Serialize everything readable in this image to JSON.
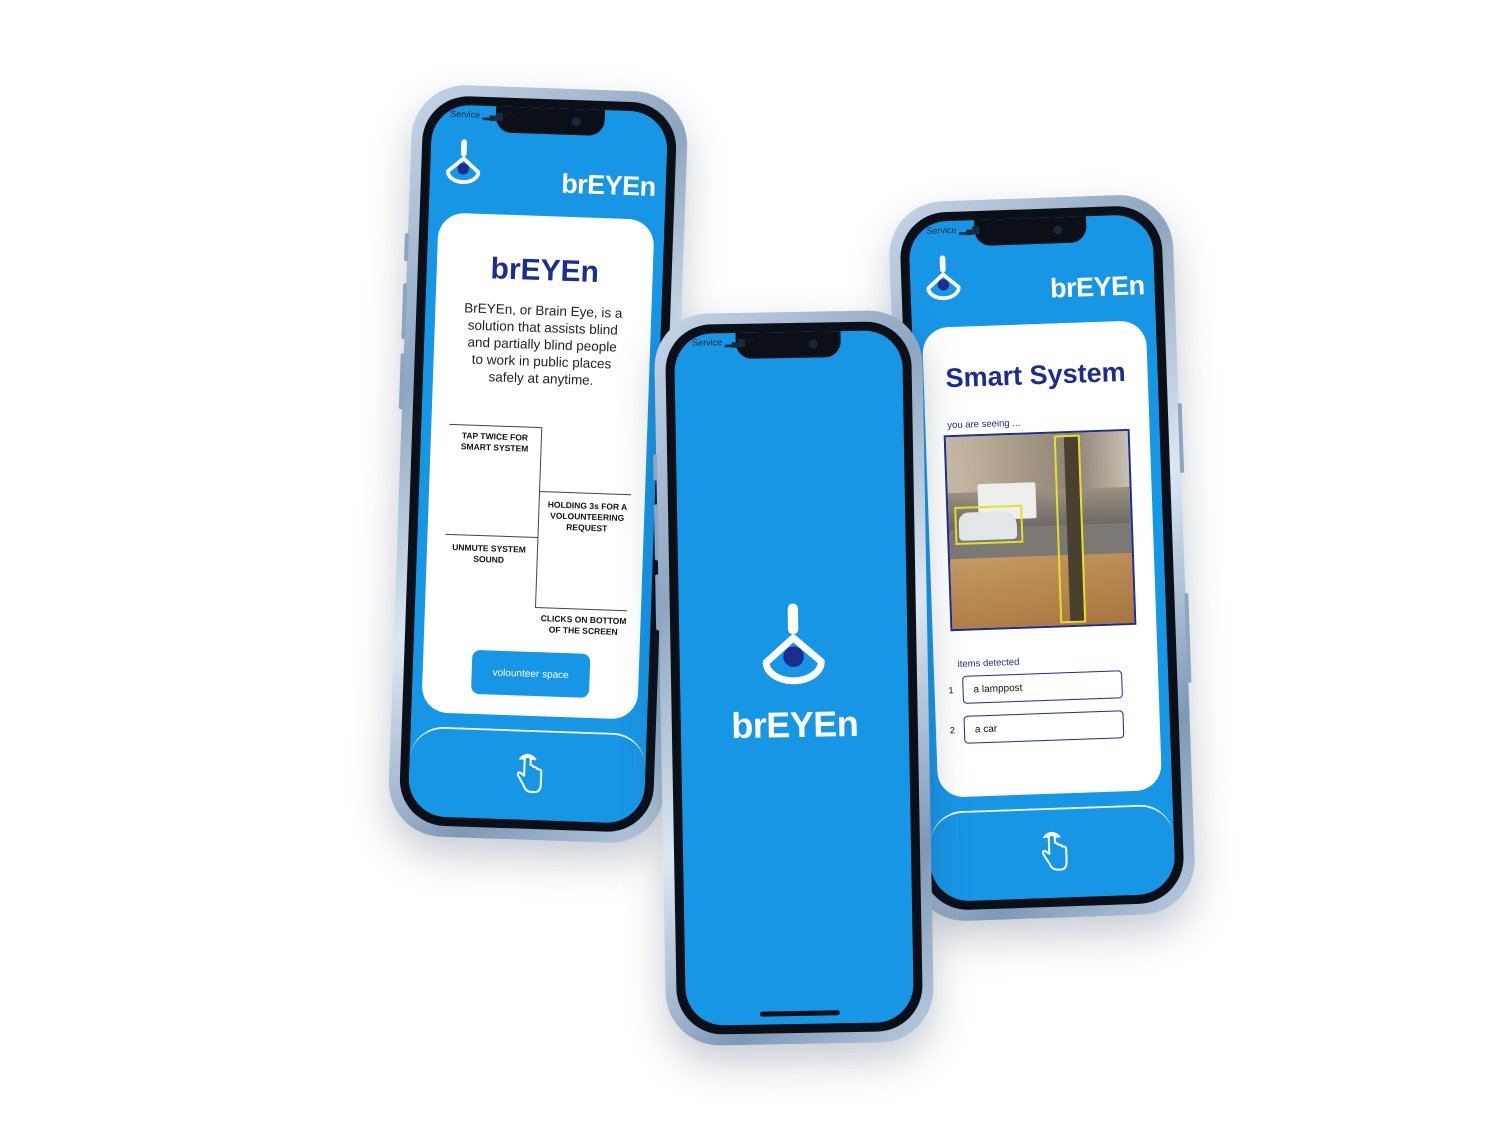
{
  "status_bar": {
    "carrier": "Service"
  },
  "app": {
    "name": "brEYEn"
  },
  "about_screen": {
    "title": "brEYEn",
    "description": "BrEYEn, or Brain Eye, is a solution that assists blind and partially blind people to work in public places safely at anytime.",
    "gestures": [
      "TAP TWICE FOR SMART SYSTEM",
      "HOLDING 3s FOR A VOLOUNTEERING REQUEST",
      "UNMUTE SYSTEM SOUND",
      "CLICKS ON BOTTOM OF THE SCREEN"
    ],
    "volunteer_button": "volounteer space"
  },
  "splash_screen": {
    "name": "brEYEn"
  },
  "smart_screen": {
    "title": "Smart System",
    "seeing_label": "you are seeing ...",
    "items_label": "items detected",
    "items": [
      {
        "num": "1",
        "label": "a lamppost"
      },
      {
        "num": "2",
        "label": "a car"
      }
    ]
  },
  "colors": {
    "primary": "#1896e6",
    "title": "#1b2d8e",
    "bbox": "#e4e02a"
  },
  "icons": {
    "logo": "eye-drop-icon",
    "tap": "tap-hand-icon"
  }
}
